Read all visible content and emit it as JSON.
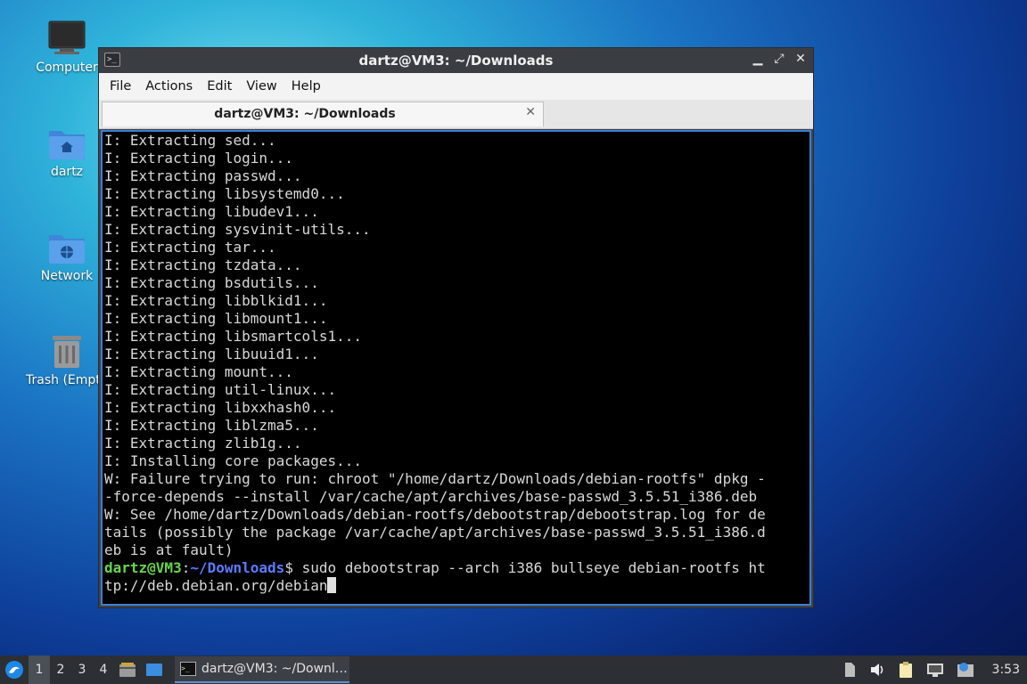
{
  "desktop": {
    "icons": [
      {
        "label": "Computer"
      },
      {
        "label": "dartz"
      },
      {
        "label": "Network"
      },
      {
        "label": "Trash (Empt"
      }
    ]
  },
  "window": {
    "title": "dartz@VM3: ~/Downloads",
    "app_icon_text": ">_",
    "buttons": {
      "minimize": "▁",
      "maximize": "⤢",
      "close": "✕"
    },
    "menu": [
      "File",
      "Actions",
      "Edit",
      "View",
      "Help"
    ],
    "tab": {
      "title": "dartz@VM3: ~/Downloads",
      "close": "✕"
    }
  },
  "terminal": {
    "lines": [
      "I: Extracting sed...",
      "I: Extracting login...",
      "I: Extracting passwd...",
      "I: Extracting libsystemd0...",
      "I: Extracting libudev1...",
      "I: Extracting sysvinit-utils...",
      "I: Extracting tar...",
      "I: Extracting tzdata...",
      "I: Extracting bsdutils...",
      "I: Extracting libblkid1...",
      "I: Extracting libmount1...",
      "I: Extracting libsmartcols1...",
      "I: Extracting libuuid1...",
      "I: Extracting mount...",
      "I: Extracting util-linux...",
      "I: Extracting libxxhash0...",
      "I: Extracting liblzma5...",
      "I: Extracting zlib1g...",
      "I: Installing core packages...",
      "W: Failure trying to run: chroot \"/home/dartz/Downloads/debian-rootfs\" dpkg -",
      "-force-depends --install /var/cache/apt/archives/base-passwd_3.5.51_i386.deb",
      "W: See /home/dartz/Downloads/debian-rootfs/debootstrap/debootstrap.log for de",
      "tails (possibly the package /var/cache/apt/archives/base-passwd_3.5.51_i386.d",
      "eb is at fault)"
    ],
    "prompt_user": "dartz@VM3",
    "prompt_sep": ":",
    "prompt_path": "~/Downloads",
    "prompt_symbol": "$ ",
    "command_line1": "sudo debootstrap --arch i386 bullseye debian-rootfs ht",
    "command_line2": "tp://deb.debian.org/debian"
  },
  "taskbar": {
    "workspaces": [
      "1",
      "2",
      "3",
      "4"
    ],
    "active_workspace": "1",
    "task_label": "dartz@VM3: ~/Downl…",
    "clock": "3:53"
  }
}
